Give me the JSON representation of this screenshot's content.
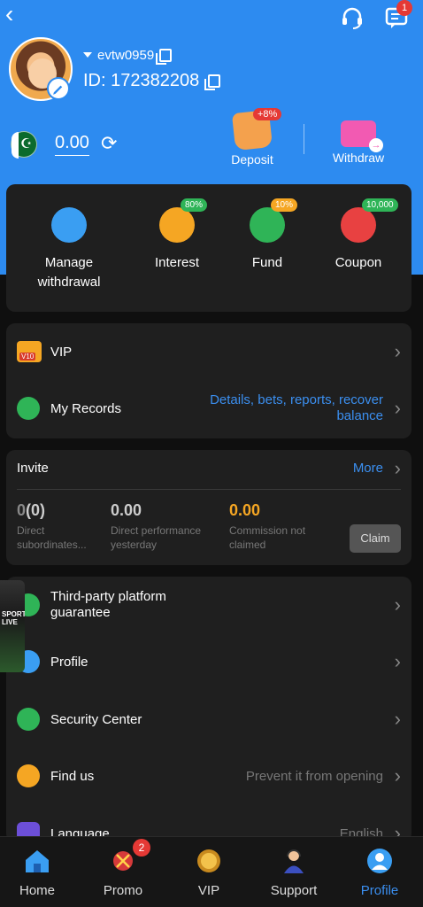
{
  "header": {
    "username": "evtw0959",
    "user_id": "ID: 172382208",
    "balance": "0.00",
    "message_badge": "1"
  },
  "top_actions": {
    "deposit": {
      "label": "Deposit",
      "badge": "+8%"
    },
    "withdraw": {
      "label": "Withdraw"
    }
  },
  "quick_actions": [
    {
      "label": "Manage withdrawal",
      "badge": "",
      "icon": "wallet-icon",
      "color": "#3a9ef2"
    },
    {
      "label": "Interest",
      "badge": "80%",
      "icon": "piggy-bank-icon",
      "color": "#f5a623"
    },
    {
      "label": "Fund",
      "badge": "10%",
      "icon": "fund-icon",
      "color": "#2fb457"
    },
    {
      "label": "Coupon",
      "badge": "10,000",
      "icon": "coupon-icon",
      "color": "#e84141"
    }
  ],
  "records": {
    "vip_label": "VIP",
    "vip_level": "V10",
    "records_label": "My Records",
    "records_hint": "Details, bets, reports, recover balance"
  },
  "invite": {
    "title": "Invite",
    "more": "More",
    "subordinates_value_main": "0",
    "subordinates_value_paren": "(0)",
    "subordinates_label": "Direct subordinates...",
    "performance_value": "0.00",
    "performance_label": "Direct performance yesterday",
    "commission_value": "0.00",
    "commission_label": "Commission not claimed",
    "claim": "Claim"
  },
  "settings": [
    {
      "label": "Third-party platform guarantee",
      "hint": "",
      "icon": "shield-check-icon",
      "color": "#2fb457"
    },
    {
      "label": "Profile",
      "hint": "",
      "icon": "profile-icon",
      "color": "#3a9ef2"
    },
    {
      "label": "Security Center",
      "hint": "",
      "icon": "security-icon",
      "color": "#2fb457"
    },
    {
      "label": "Find us",
      "hint": "Prevent it from opening",
      "icon": "find-us-icon",
      "color": "#f5a623"
    },
    {
      "label": "Language",
      "hint": "English",
      "icon": "language-icon",
      "color": "#6c4fd8"
    }
  ],
  "side_promo": {
    "text": "SPORTS LIVE"
  },
  "bottom_nav": [
    {
      "label": "Home"
    },
    {
      "label": "Promo",
      "badge": "2"
    },
    {
      "label": "VIP"
    },
    {
      "label": "Support"
    },
    {
      "label": "Profile"
    }
  ],
  "colors": {
    "primary": "#2d8bf0",
    "link": "#3b8ff0",
    "commission": "#f5a623",
    "badge_red": "#e53935",
    "badge_green": "#2fb457",
    "badge_orange": "#f5a623"
  }
}
